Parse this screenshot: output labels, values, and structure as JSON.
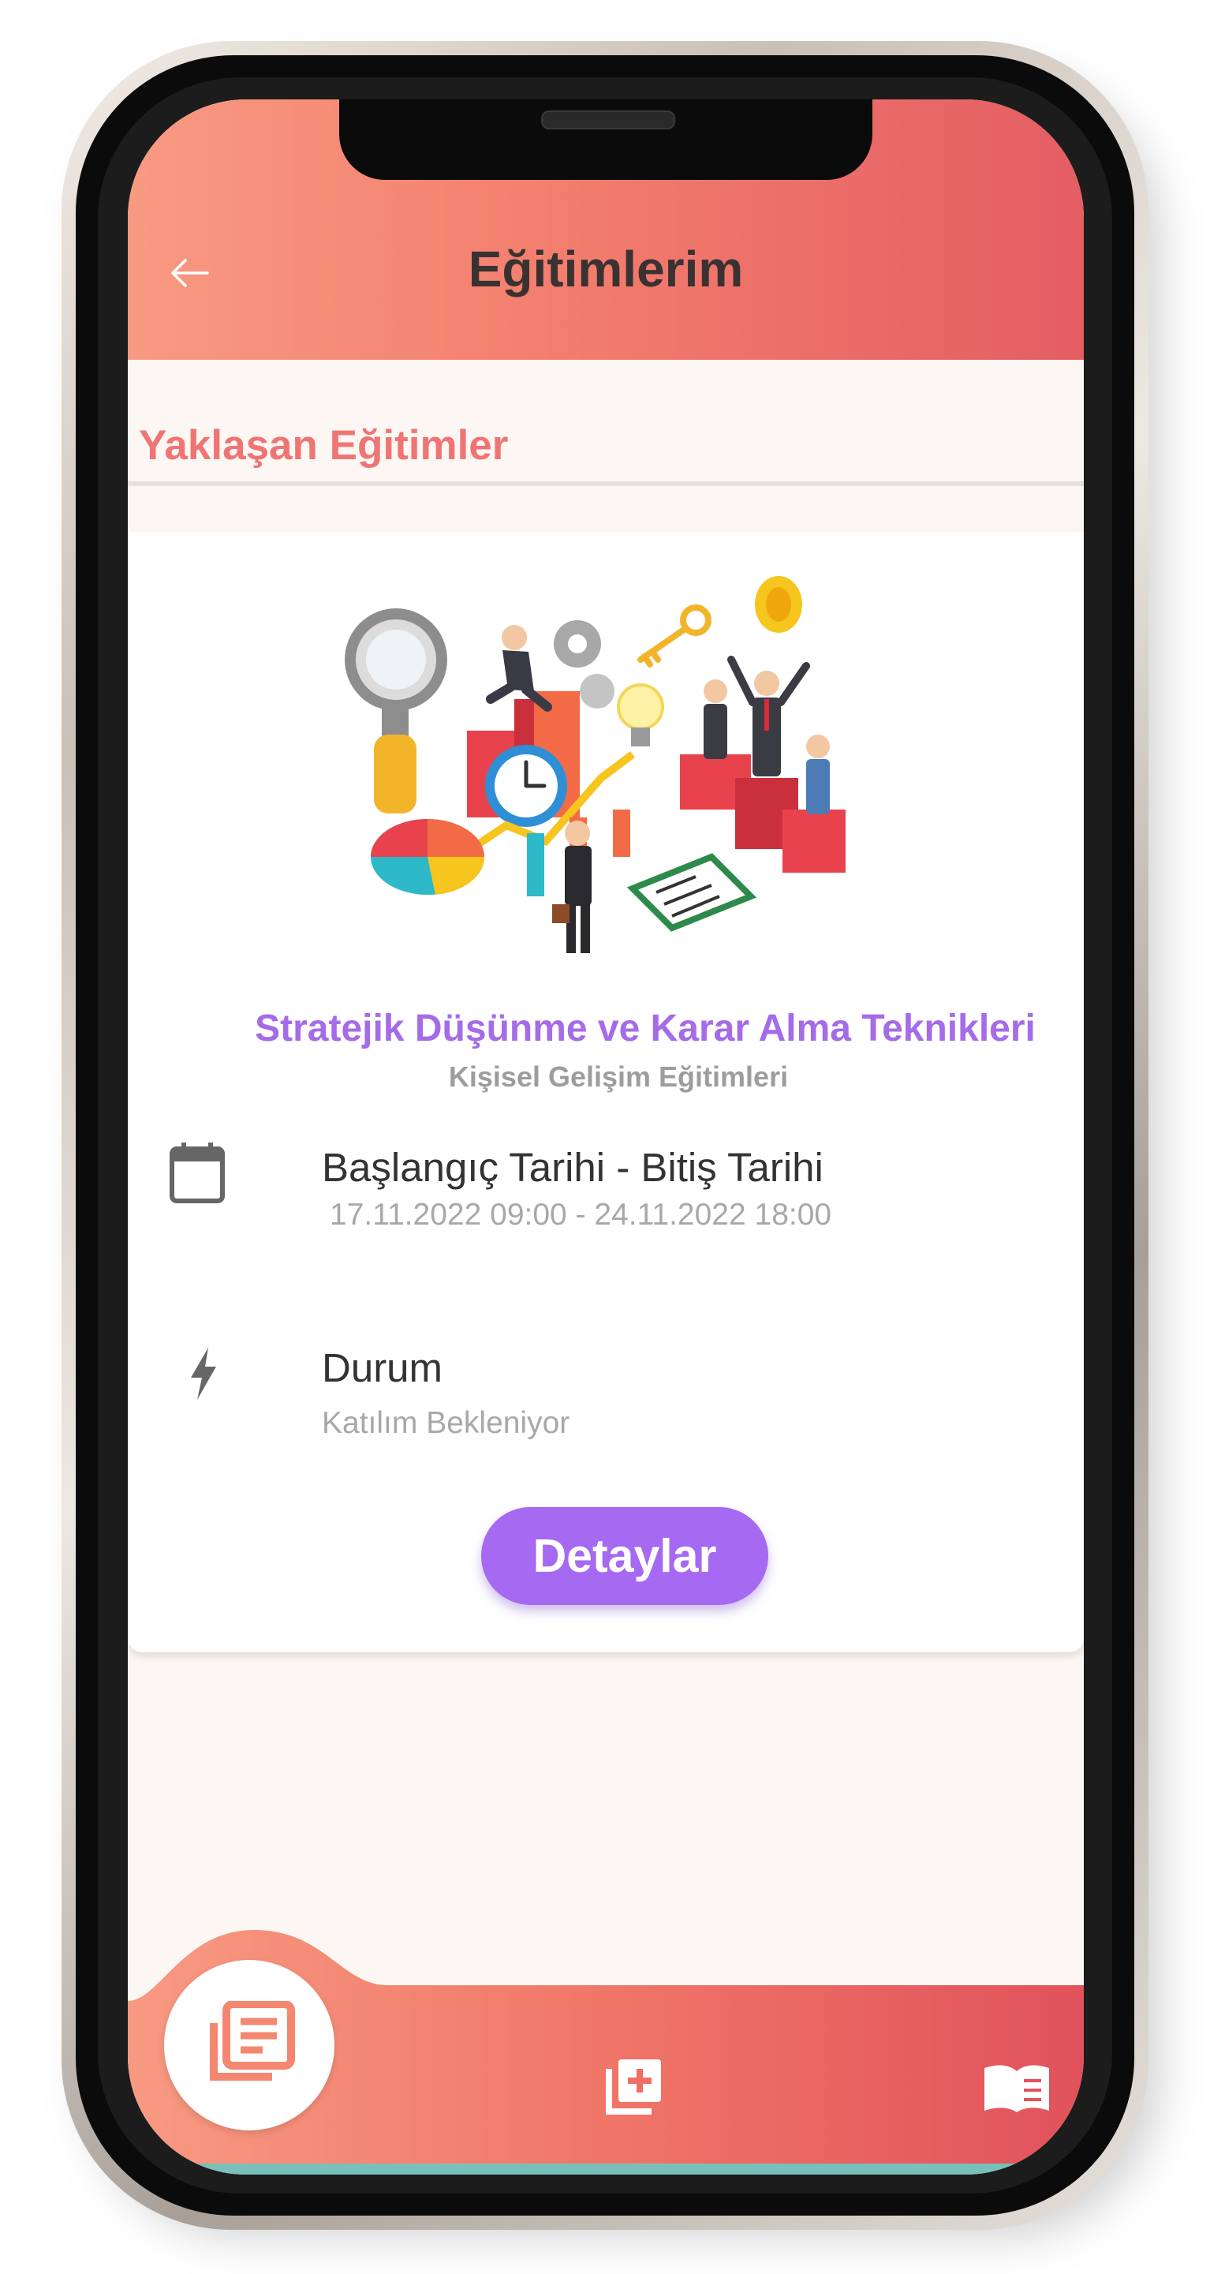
{
  "header": {
    "title": "Eğitimlerim",
    "back_icon": "arrow-left-icon"
  },
  "section": {
    "title": "Yaklaşan Eğitimler"
  },
  "course": {
    "illustration": "business-strategy-illustration",
    "title": "Stratejik Düşünme ve Karar Alma Teknikleri",
    "category": "Kişisel Gelişim Eğitimleri",
    "date_icon": "calendar-icon",
    "date_label": "Başlangıç Tarihi - Bitiş Tarihi",
    "date_value": "17.11.2022 09:00 - 24.11.2022 18:00",
    "status_icon": "lightning-icon",
    "status_label": "Durum",
    "status_value": "Katılım Bekleniyor",
    "details_button": "Detaylar"
  },
  "bottom_nav": {
    "items": [
      {
        "icon": "course-list-icon",
        "active": true
      },
      {
        "icon": "add-course-icon",
        "active": false
      },
      {
        "icon": "open-book-icon",
        "active": false
      }
    ]
  },
  "colors": {
    "header_gradient_start": "#f89a82",
    "header_gradient_end": "#e45d63",
    "section_title": "#ef7574",
    "accent_purple": "#a569f2",
    "background": "#fdf7f3"
  }
}
